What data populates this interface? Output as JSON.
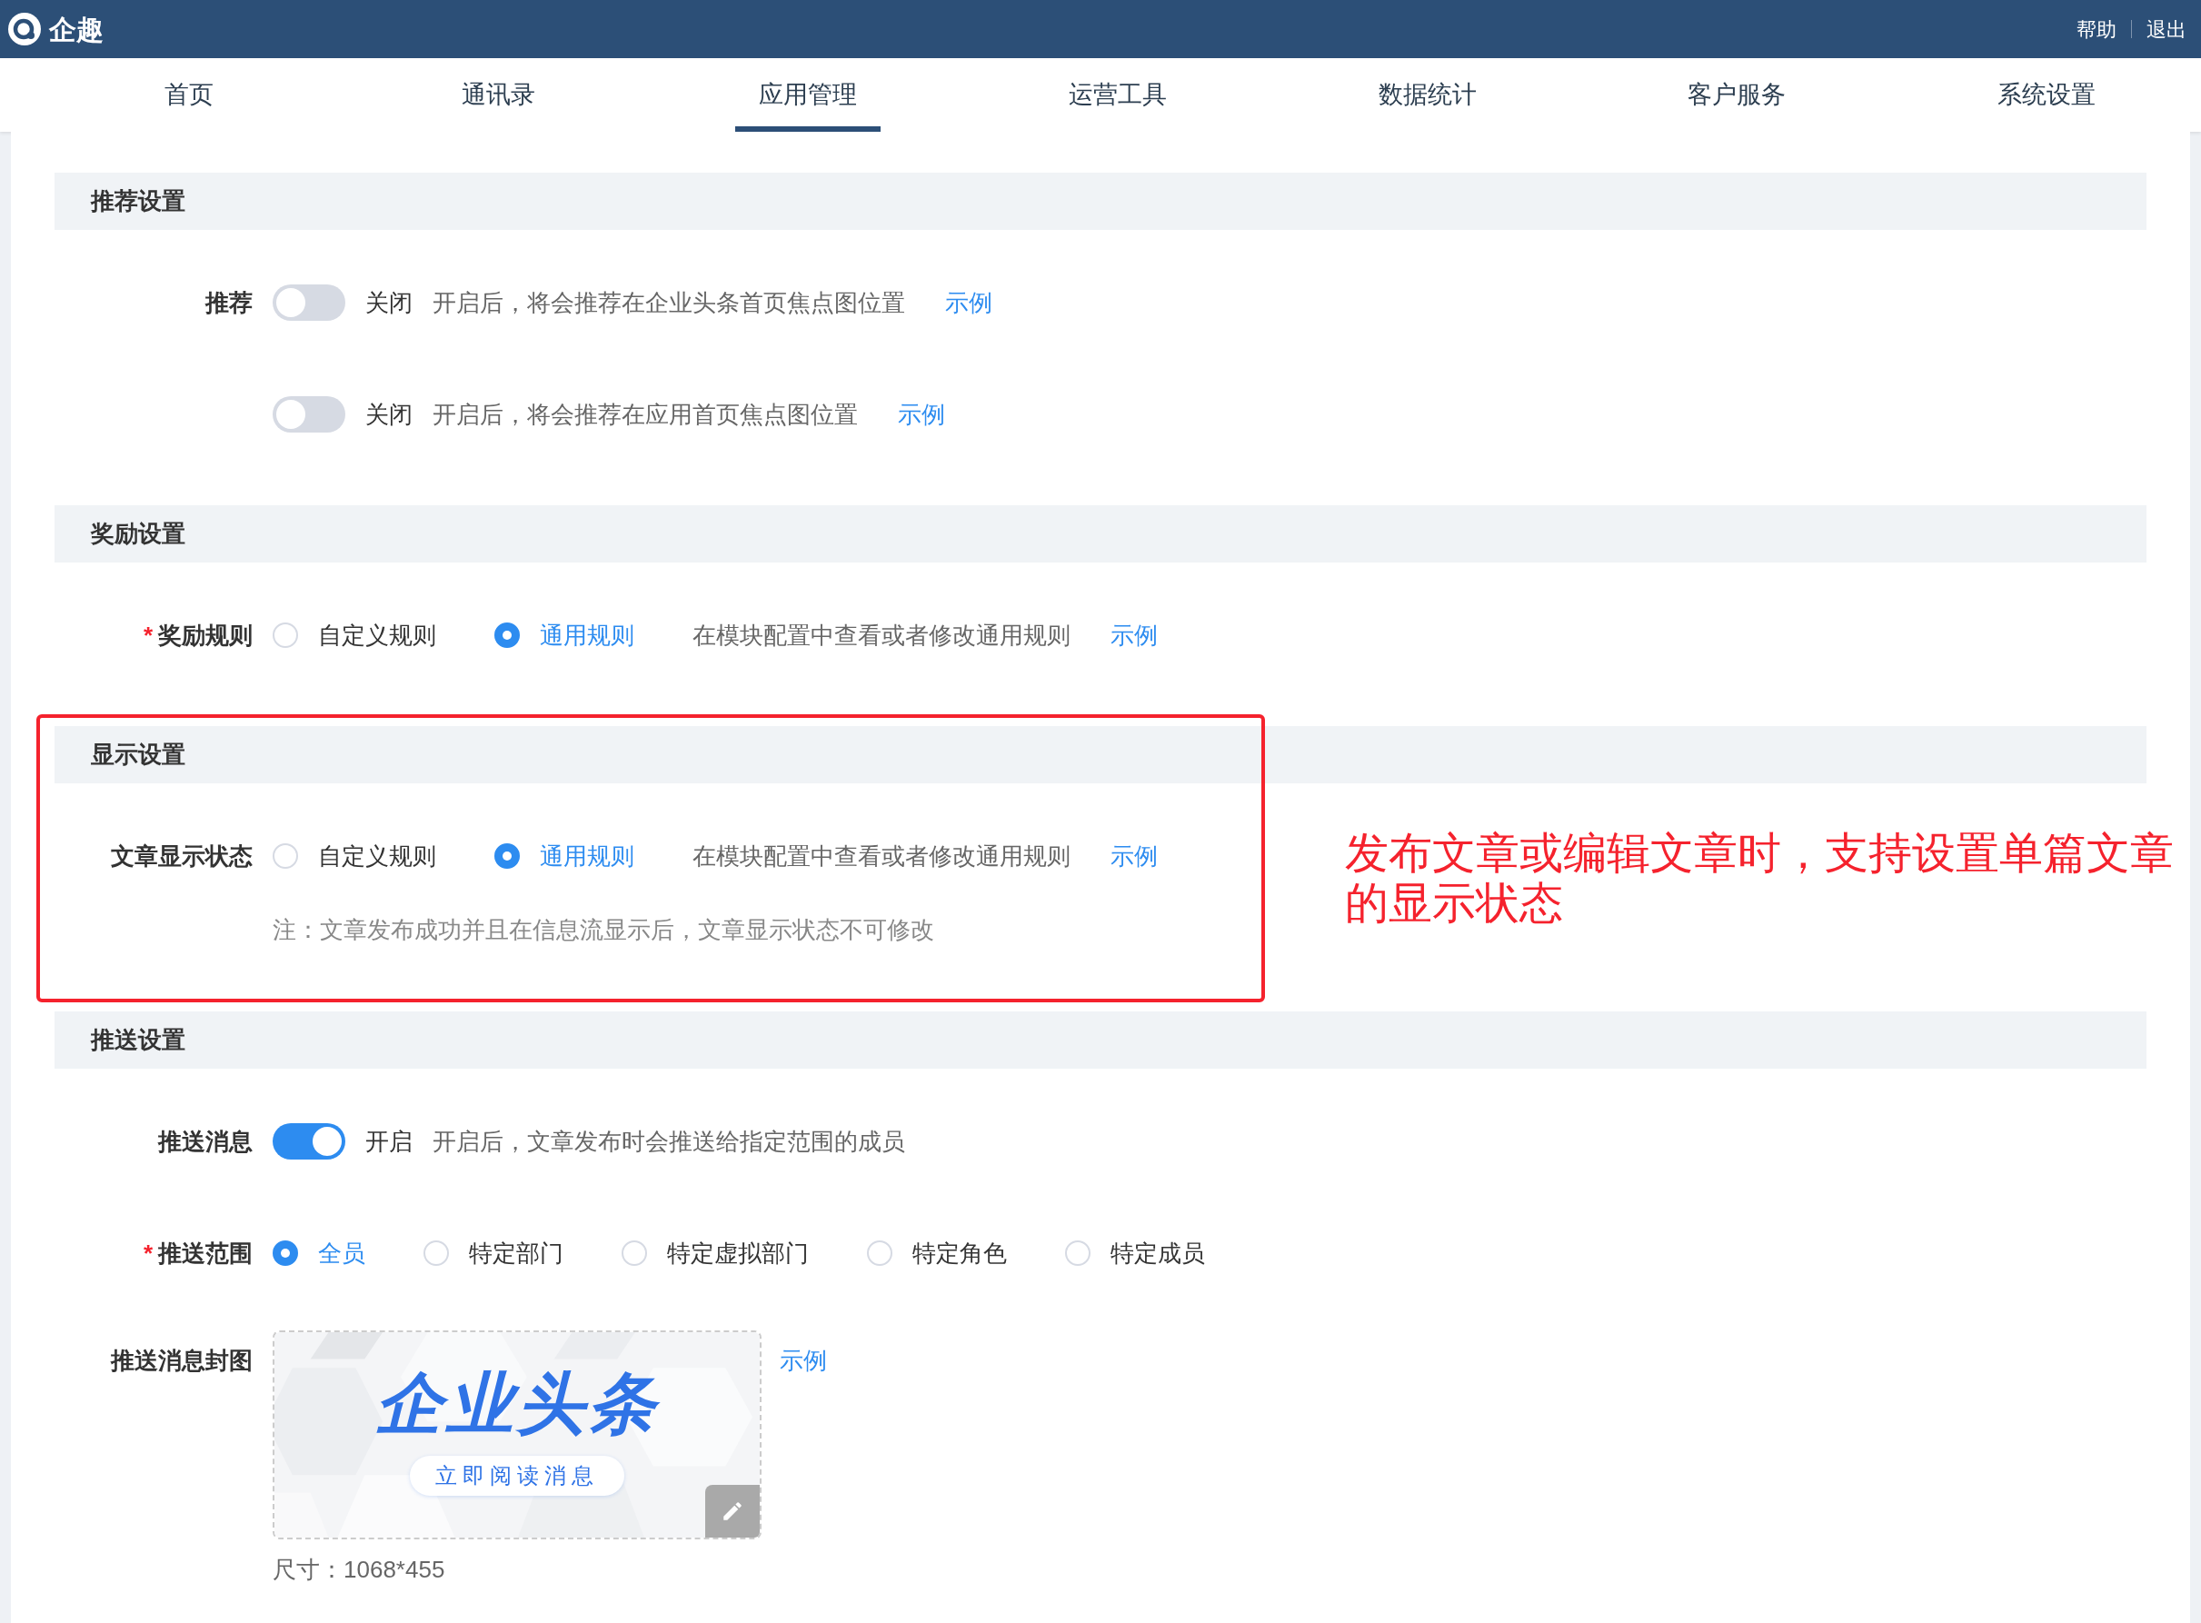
{
  "app": {
    "name": "企趣"
  },
  "header_links": [
    "帮助",
    "退出"
  ],
  "nav": [
    {
      "label": "首页",
      "selected": false
    },
    {
      "label": "通讯录",
      "selected": false
    },
    {
      "label": "应用管理",
      "selected": true
    },
    {
      "label": "运营工具",
      "selected": false
    },
    {
      "label": "数据统计",
      "selected": false
    },
    {
      "label": "客户服务",
      "selected": false
    },
    {
      "label": "系统设置",
      "selected": false
    }
  ],
  "sections": [
    {
      "title": "推荐设置",
      "rows": [
        {
          "kind": "toggle",
          "label": "推荐",
          "on": false,
          "state_text": "关闭",
          "description": "开启后，将会推荐在企业头条首页焦点图位置",
          "link": "示例"
        },
        {
          "kind": "toggle",
          "on": false,
          "state_text": "关闭",
          "description": "开启后，将会推荐在应用首页焦点图位置",
          "link": "示例"
        }
      ]
    },
    {
      "title": "奖励设置",
      "rows": [
        {
          "kind": "radio",
          "label": "奖励规则",
          "required_mark": "*",
          "options": [
            {
              "label": "自定义规则",
              "selected": false
            },
            {
              "label": "通用规则",
              "selected": true
            }
          ],
          "description": "在模块配置中查看或者修改通用规则",
          "link": "示例"
        }
      ]
    },
    {
      "title": "显示设置",
      "highlighted": true,
      "rows": [
        {
          "kind": "radio",
          "label": "文章显示状态",
          "options": [
            {
              "label": "自定义规则",
              "selected": false
            },
            {
              "label": "通用规则",
              "selected": true
            }
          ],
          "description": "在模块配置中查看或者修改通用规则",
          "link": "示例",
          "note": "注：文章发布成功并且在信息流显示后，文章显示状态不可修改"
        }
      ]
    },
    {
      "title": "推送设置",
      "rows": [
        {
          "kind": "toggle",
          "label": "推送消息",
          "on": true,
          "state_text": "开启",
          "description": "开启后，文章发布时会推送给指定范围的成员"
        },
        {
          "kind": "radio",
          "label": "推送范围",
          "required_mark": "*",
          "options": [
            {
              "label": "全员",
              "selected": true
            },
            {
              "label": "特定部门",
              "selected": false
            },
            {
              "label": "特定虚拟部门",
              "selected": false
            },
            {
              "label": "特定角色",
              "selected": false
            },
            {
              "label": "特定成员",
              "selected": false
            }
          ]
        },
        {
          "kind": "upload",
          "label": "推送消息封图",
          "cover": {
            "title": "企业头条",
            "button": "立即阅读消息"
          },
          "link": "示例",
          "size_text": "尺寸：1068*455"
        }
      ]
    }
  ],
  "annotation": {
    "text": "发布文章或编辑文章时，支持设置单篇文章的显示状态"
  }
}
